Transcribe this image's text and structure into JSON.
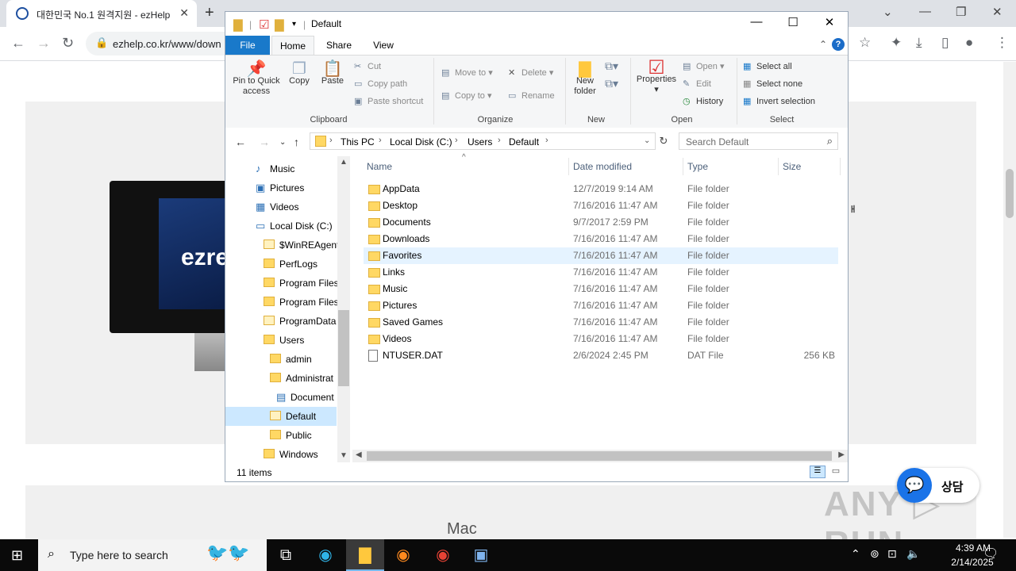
{
  "browser": {
    "tab_title": "대한민국 No.1 원격지원 - ezHelp",
    "tab_close": "✕",
    "new_tab": "+",
    "url": "ezhelp.co.kr/www/down",
    "back": "←",
    "forward": "→",
    "reload": "↻",
    "lock": "🔒",
    "win_min": "—",
    "win_max": "❐",
    "win_close": "✕",
    "tab_search": "⌄"
  },
  "page": {
    "logo_text": "ezre",
    "mac_label": "Mac",
    "chat_label": "상담",
    "chat_icon": "💬",
    "watermark": "ANY ▷ RUN",
    "side_glyph": "ᅢ"
  },
  "explorer": {
    "title": "Default",
    "tabs": {
      "file": "File",
      "home": "Home",
      "share": "Share",
      "view": "View"
    },
    "ribbon": {
      "pin": "Pin to Quick access",
      "copy": "Copy",
      "paste": "Paste",
      "cut": "Cut",
      "copy_path": "Copy path",
      "paste_shortcut": "Paste shortcut",
      "move_to": "Move to",
      "copy_to": "Copy to",
      "delete": "Delete",
      "rename": "Rename",
      "new_folder": "New folder",
      "properties": "Properties",
      "open": "Open",
      "edit": "Edit",
      "history": "History",
      "select_all": "Select all",
      "select_none": "Select none",
      "invert_selection": "Invert selection",
      "groups": {
        "clipboard": "Clipboard",
        "organize": "Organize",
        "new": "New",
        "open": "Open",
        "select": "Select"
      }
    },
    "address": {
      "crumbs": [
        "This PC",
        "Local Disk (C:)",
        "Users",
        "Default"
      ],
      "search_placeholder": "Search Default"
    },
    "nav": [
      {
        "label": "Music",
        "kind": "music"
      },
      {
        "label": "Pictures",
        "kind": "pictures"
      },
      {
        "label": "Videos",
        "kind": "videos"
      },
      {
        "label": "Local Disk (C:)",
        "kind": "drive"
      },
      {
        "label": "$WinREAgent",
        "kind": "folder-pale"
      },
      {
        "label": "PerfLogs",
        "kind": "folder"
      },
      {
        "label": "Program Files",
        "kind": "folder"
      },
      {
        "label": "Program Files",
        "kind": "folder"
      },
      {
        "label": "ProgramData",
        "kind": "folder-pale"
      },
      {
        "label": "Users",
        "kind": "folder"
      },
      {
        "label": "admin",
        "kind": "folder"
      },
      {
        "label": "Administrat",
        "kind": "folder"
      },
      {
        "label": "Document",
        "kind": "doc"
      },
      {
        "label": "Default",
        "kind": "folder-pale"
      },
      {
        "label": "Public",
        "kind": "folder"
      },
      {
        "label": "Windows",
        "kind": "folder"
      }
    ],
    "columns": {
      "name": "Name",
      "date": "Date modified",
      "type": "Type",
      "size": "Size"
    },
    "files": [
      {
        "name": "AppData",
        "date": "12/7/2019 9:14 AM",
        "type": "File folder",
        "size": ""
      },
      {
        "name": "Desktop",
        "date": "7/16/2016 11:47 AM",
        "type": "File folder",
        "size": ""
      },
      {
        "name": "Documents",
        "date": "9/7/2017 2:59 PM",
        "type": "File folder",
        "size": ""
      },
      {
        "name": "Downloads",
        "date": "7/16/2016 11:47 AM",
        "type": "File folder",
        "size": ""
      },
      {
        "name": "Favorites",
        "date": "7/16/2016 11:47 AM",
        "type": "File folder",
        "size": ""
      },
      {
        "name": "Links",
        "date": "7/16/2016 11:47 AM",
        "type": "File folder",
        "size": ""
      },
      {
        "name": "Music",
        "date": "7/16/2016 11:47 AM",
        "type": "File folder",
        "size": ""
      },
      {
        "name": "Pictures",
        "date": "7/16/2016 11:47 AM",
        "type": "File folder",
        "size": ""
      },
      {
        "name": "Saved Games",
        "date": "7/16/2016 11:47 AM",
        "type": "File folder",
        "size": ""
      },
      {
        "name": "Videos",
        "date": "7/16/2016 11:47 AM",
        "type": "File folder",
        "size": ""
      },
      {
        "name": "NTUSER.DAT",
        "date": "2/6/2024 2:45 PM",
        "type": "DAT File",
        "size": "256 KB"
      }
    ],
    "status": "11 items"
  },
  "taskbar": {
    "search_placeholder": "Type here to search",
    "time": "4:39 AM",
    "date": "2/14/2025"
  },
  "colors": {
    "accent": "#1979ca",
    "selection": "#cce8ff",
    "hover": "#e5f3ff",
    "folder": "#ffd864"
  }
}
